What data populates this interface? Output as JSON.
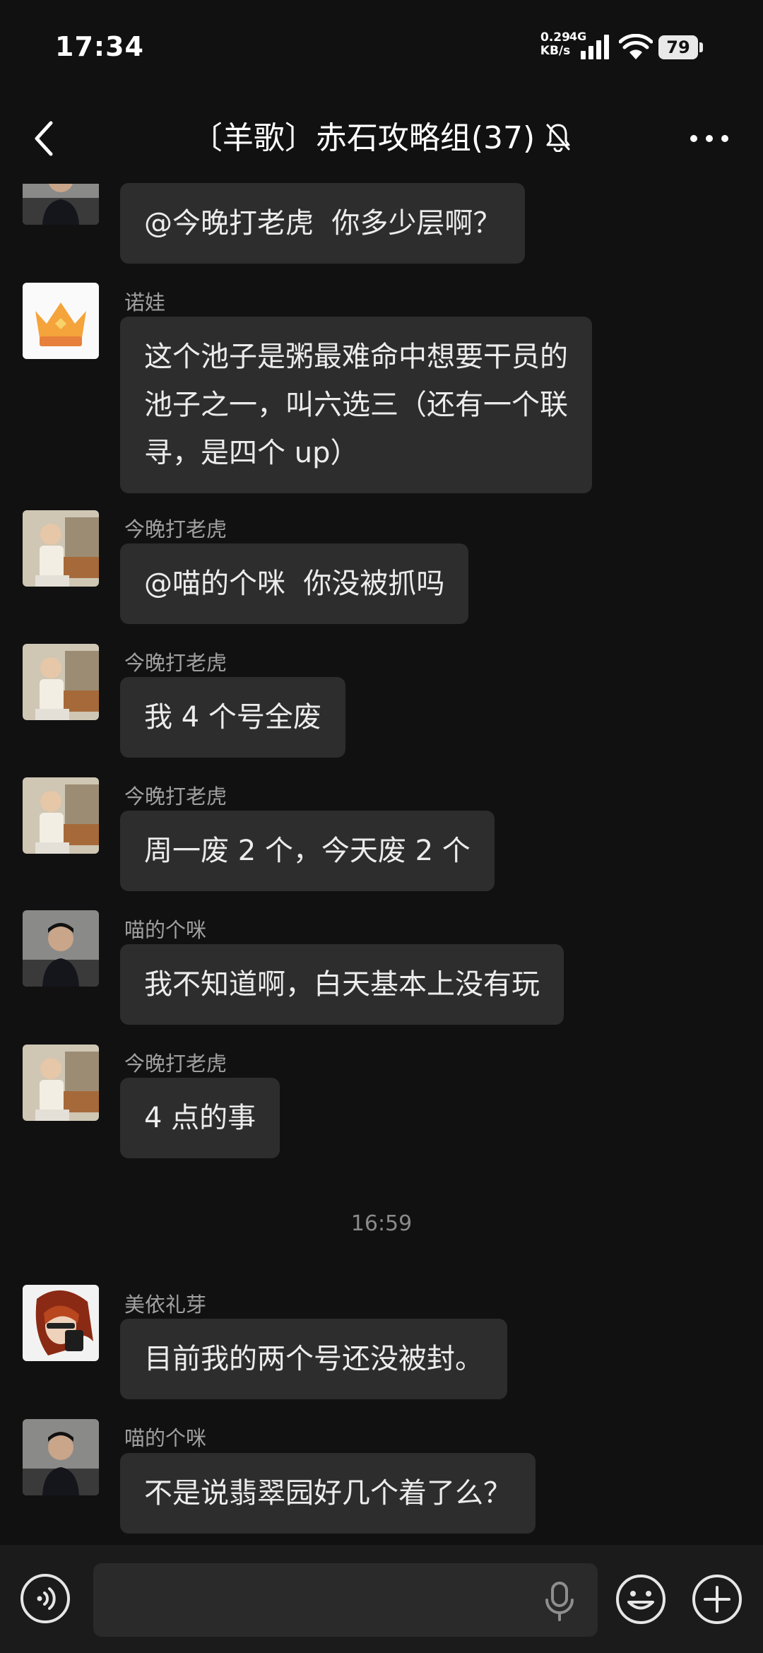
{
  "status_bar": {
    "time": "17:34",
    "net_speed_value": "0.29",
    "net_speed_unit": "KB/s",
    "network_type": "4G",
    "battery": "79"
  },
  "header": {
    "title": "〔羊歌〕赤石攻略组(37)",
    "back_icon": "chevron-left-icon",
    "mute_icon": "bell-off-icon",
    "more_icon": "more-dots-icon"
  },
  "messages": [
    {
      "sender": "",
      "text": "@今晚打老虎  你多少层啊？",
      "avatar": "person-photo"
    },
    {
      "sender": "诺娃",
      "text": "这个池子是粥最难命中想要干员的\n池子之一，叫六选三（还有一个联\n寻，是四个 up）",
      "avatar": "crown"
    },
    {
      "sender": "今晚打老虎",
      "text": "@喵的个咪  你没被抓吗",
      "avatar": "child-photo"
    },
    {
      "sender": "今晚打老虎",
      "text": "我 4 个号全废",
      "avatar": "child-photo"
    },
    {
      "sender": "今晚打老虎",
      "text": "周一废 2 个，今天废 2 个",
      "avatar": "child-photo"
    },
    {
      "sender": "喵的个咪",
      "text": "我不知道啊，白天基本上没有玩",
      "avatar": "person-photo"
    },
    {
      "sender": "今晚打老虎",
      "text": "4 点的事",
      "avatar": "child-photo"
    },
    {
      "sender": "美依礼芽",
      "text": "目前我的两个号还没被封。",
      "avatar": "singer-photo"
    },
    {
      "sender": "喵的个咪",
      "text": "不是说翡翠园好几个着了么？",
      "avatar": "person-photo"
    }
  ],
  "timestamp": "16:59",
  "input_bar": {
    "placeholder": "",
    "voice_icon": "voice-icon",
    "mic_icon": "microphone-icon",
    "emoji_icon": "emoji-icon",
    "plus_icon": "plus-icon"
  },
  "colors": {
    "background": "#111111",
    "bubble": "#2d2d2d",
    "sender_text": "#a0a0a0",
    "input_bar": "#1b1b1b"
  }
}
